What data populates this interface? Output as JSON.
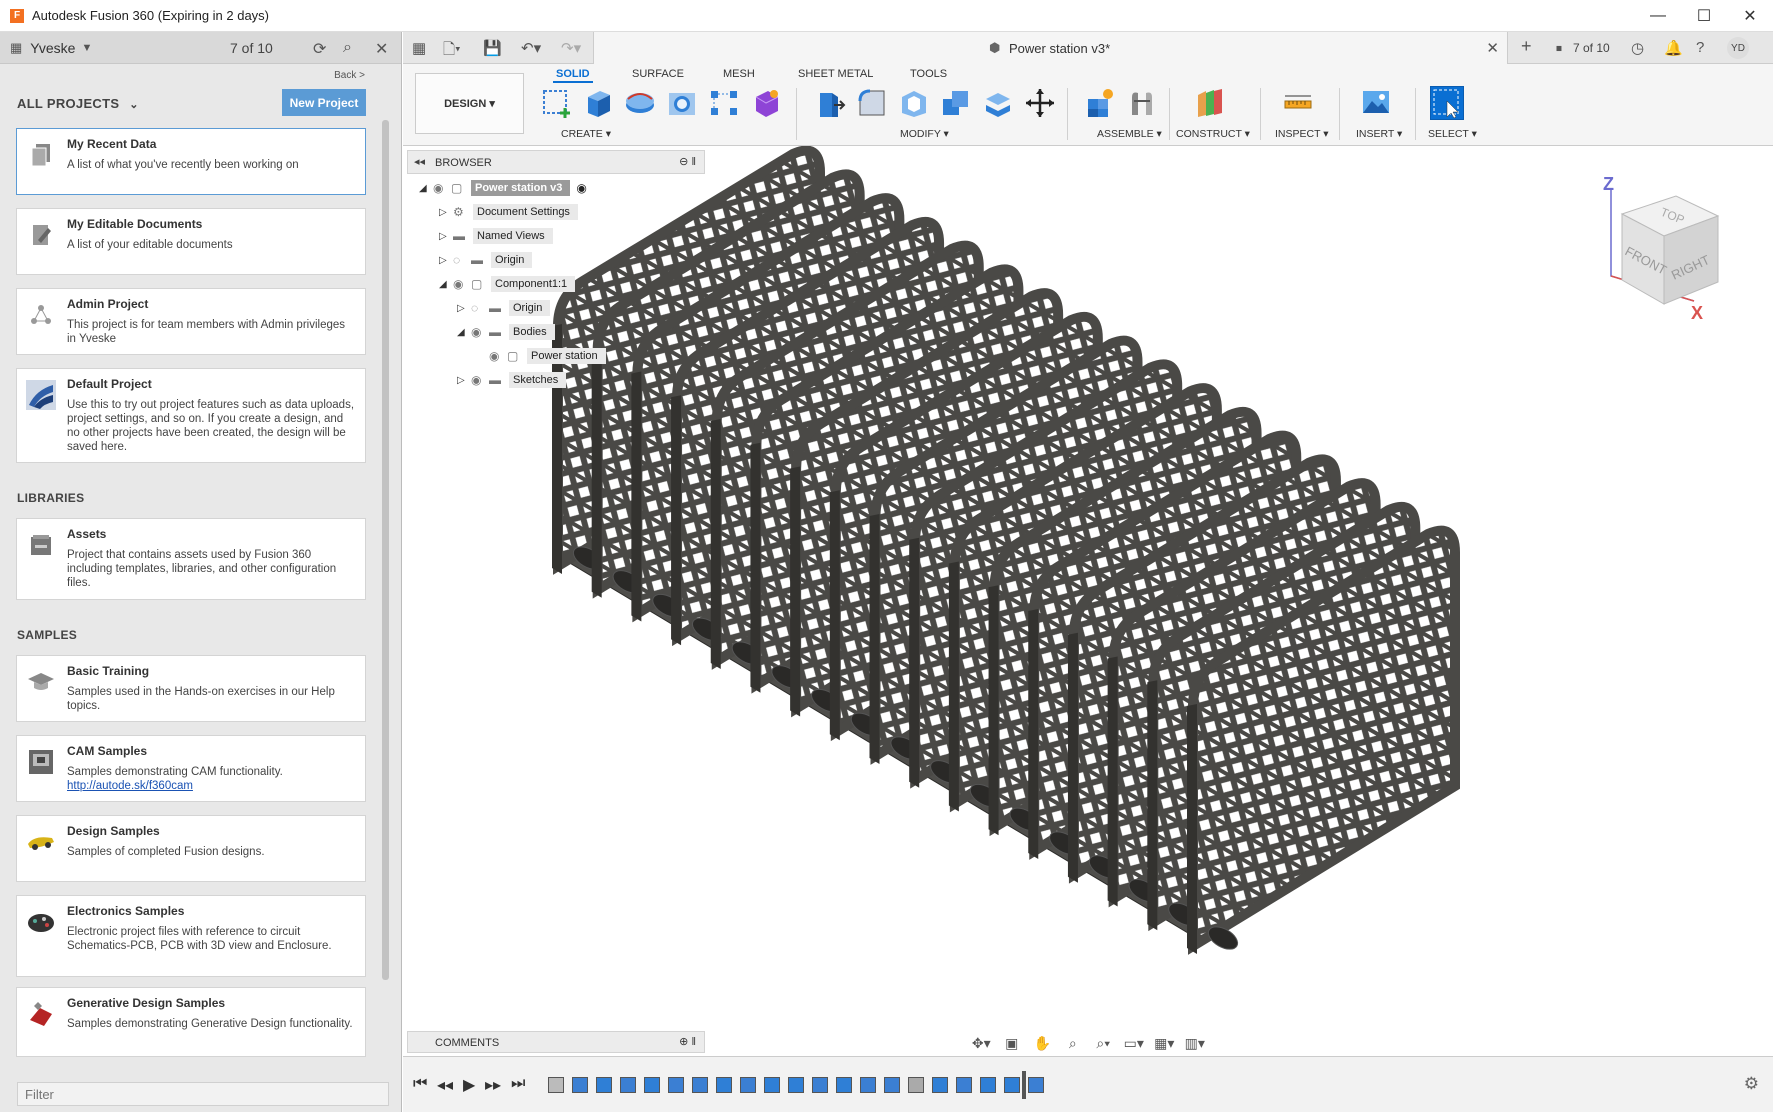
{
  "window": {
    "title": "Autodesk Fusion 360 (Expiring in 2 days)",
    "app_icon_letter": "F",
    "controls": [
      "—",
      "☐",
      "✕"
    ]
  },
  "data_panel": {
    "team": "Yveske",
    "jobs": "7 of 10",
    "back": "Back >",
    "section_all_projects": "ALL PROJECTS",
    "new_project": "New Project",
    "projects": [
      {
        "title": "My Recent Data",
        "desc": "A list of what you've recently been working on",
        "icon": "document-stack-icon"
      },
      {
        "title": "My Editable Documents",
        "desc": "A list of your editable documents",
        "icon": "edit-document-icon"
      },
      {
        "title": "Admin Project",
        "desc": "This project is for team members with Admin privileges in Yveske",
        "icon": "admin-icon"
      },
      {
        "title": "Default Project",
        "desc": "Use this to try out project features such as data uploads, project settings, and so on. If you create a design, and no other projects have been created, the design will be saved here.",
        "icon": "default-project-icon"
      }
    ],
    "section_libraries": "LIBRARIES",
    "libraries": [
      {
        "title": "Assets",
        "desc": "Project that contains assets used by Fusion 360 including templates, libraries, and other configuration files.",
        "icon": "assets-icon"
      }
    ],
    "section_samples": "SAMPLES",
    "samples": [
      {
        "title": "Basic Training",
        "desc": "Samples used in the Hands-on exercises in our Help topics.",
        "link": "",
        "icon": "graduation-cap-icon"
      },
      {
        "title": "CAM Samples",
        "desc": "Samples demonstrating CAM functionality.",
        "link": "http://autode.sk/f360cam",
        "icon": "cam-machine-icon"
      },
      {
        "title": "Design Samples",
        "desc": "Samples of completed Fusion designs.",
        "link": "",
        "icon": "design-sample-icon"
      },
      {
        "title": "Electronics Samples",
        "desc": "Electronic project files with reference to circuit Schematics-PCB, PCB with 3D view and Enclosure.",
        "link": "",
        "icon": "electronics-icon"
      },
      {
        "title": "Generative Design Samples",
        "desc": "Samples demonstrating Generative Design functionality.",
        "link": "",
        "icon": "generative-design-icon"
      }
    ],
    "filter_placeholder": "Filter"
  },
  "tab_bar": {
    "document_name": "Power station v3*",
    "jobs": "7 of 10",
    "avatar": "YD"
  },
  "toolbar": {
    "workspace": "DESIGN ▾",
    "ribbon_tabs": [
      "SOLID",
      "SURFACE",
      "MESH",
      "SHEET METAL",
      "TOOLS"
    ],
    "active_tab": "SOLID",
    "groups": {
      "create": "CREATE ▾",
      "modify": "MODIFY ▾",
      "assemble": "ASSEMBLE ▾",
      "construct": "CONSTRUCT ▾",
      "inspect": "INSPECT ▾",
      "insert": "INSERT ▾",
      "select": "SELECT ▾"
    }
  },
  "browser": {
    "label": "BROWSER",
    "items": [
      {
        "label": "Power station v3",
        "level": 0
      },
      {
        "label": "Document Settings",
        "level": 1
      },
      {
        "label": "Named Views",
        "level": 1
      },
      {
        "label": "Origin",
        "level": 1
      },
      {
        "label": "Component1:1",
        "level": 1
      },
      {
        "label": "Origin",
        "level": 2
      },
      {
        "label": "Bodies",
        "level": 2
      },
      {
        "label": "Power station",
        "level": 3
      },
      {
        "label": "Sketches",
        "level": 2
      }
    ]
  },
  "viewcube": {
    "top": "TOP",
    "front": "FRONT",
    "right": "RIGHT",
    "z": "Z",
    "x": "X"
  },
  "comments": {
    "label": "COMMENTS"
  },
  "colors": {
    "accent": "#0a6fd3",
    "new_project_button": "#5b9bd5",
    "model_body": "#4a4946",
    "model_edge": "#2b2a28"
  }
}
